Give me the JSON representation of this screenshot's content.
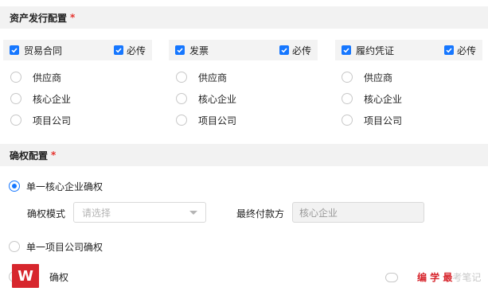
{
  "asset_config": {
    "title": "资产发行配置",
    "required_mark": "*",
    "columns": [
      {
        "type_label": "贸易合同",
        "must_label": "必传",
        "options": [
          "供应商",
          "核心企业",
          "项目公司"
        ]
      },
      {
        "type_label": "发票",
        "must_label": "必传",
        "options": [
          "供应商",
          "核心企业",
          "项目公司"
        ]
      },
      {
        "type_label": "履约凭证",
        "must_label": "必传",
        "options": [
          "供应商",
          "核心企业",
          "项目公司"
        ]
      }
    ]
  },
  "confirm_config": {
    "title": "确权配置",
    "required_mark": "*",
    "option_single_core": "单一核心企业确权",
    "mode_label": "确权模式",
    "mode_placeholder": "请选择",
    "final_payer_label": "最终付款方",
    "final_payer_value": "核心企业",
    "option_single_project": "单一项目公司确权",
    "option_partial": "确权"
  },
  "watermark": {
    "logo_letter": "W",
    "text_red": "编 学 最",
    "text_gray": "考笔记"
  },
  "colors": {
    "accent": "#1677ff",
    "required": "#e5322d",
    "header_bg": "#f2f2f2"
  },
  "icons": [
    "checkbox-checked-icon",
    "radio-icon",
    "chevron-down-icon",
    "wechat-icon"
  ]
}
